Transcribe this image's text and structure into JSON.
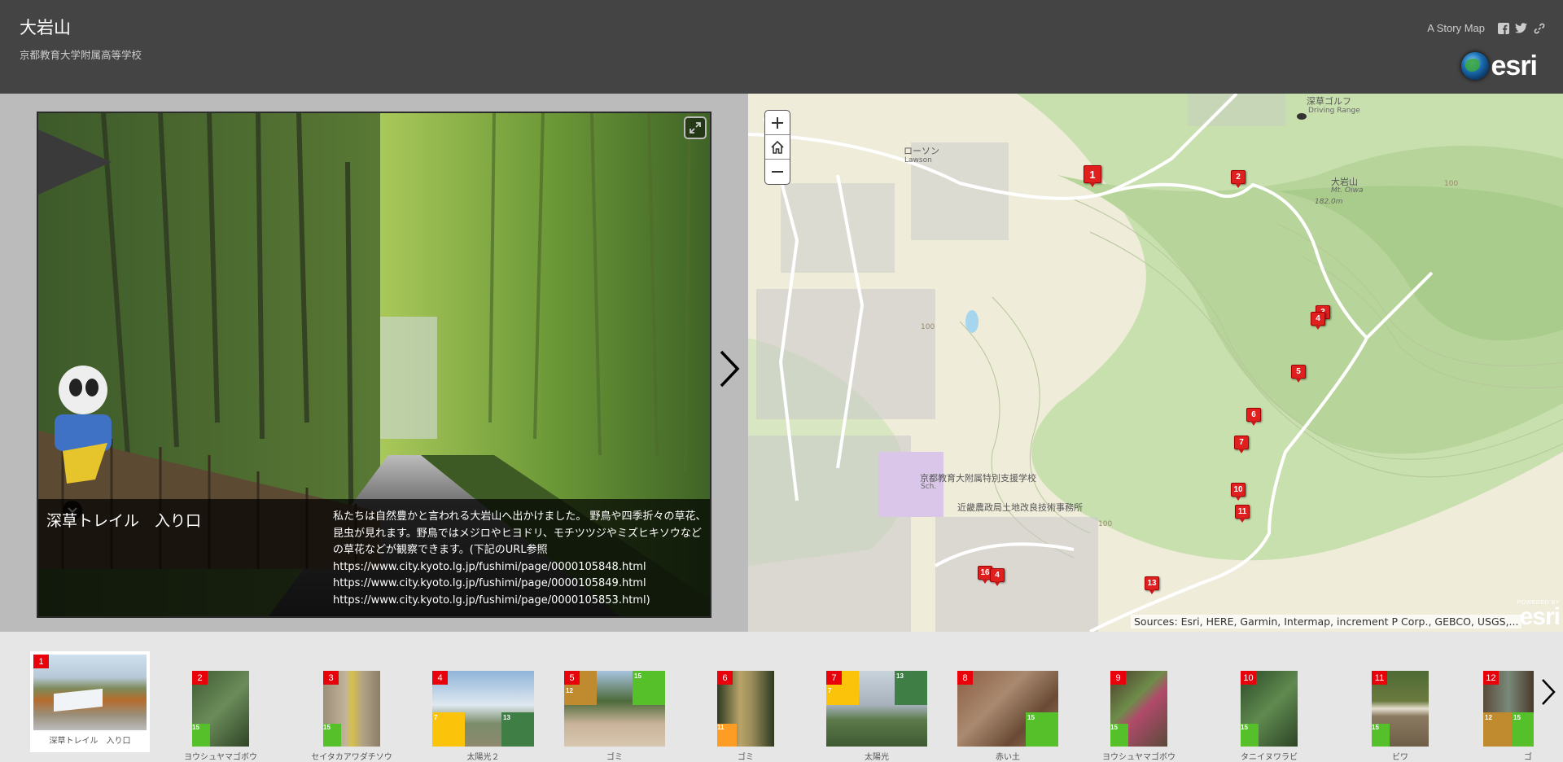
{
  "header": {
    "title": "大岩山",
    "subtitle": "京都教育大学附属高等学校",
    "story_map_label": "A Story Map",
    "share_icons": [
      "facebook-icon",
      "twitter-icon",
      "link-icon"
    ],
    "brand": "esri"
  },
  "media": {
    "caption_title": "深草トレイル　入り口",
    "caption_paragraph": "私たちは自然豊かと言われる大岩山へ出かけました。 野鳥や四季折々の草花、昆虫が見れます。野鳥ではメジロやヒヨドリ、モチツツジやミズヒキソウなどの草花などが観察できます。(下記のURL参照",
    "caption_links": [
      "https://www.city.kyoto.lg.jp/fushimi/page/0000105848.html",
      "https://www.city.kyoto.lg.jp/fushimi/page/0000105849.html",
      "https://www.city.kyoto.lg.jp/fushimi/page/0000105853.html)"
    ]
  },
  "map": {
    "zoom_in": "+",
    "home": "home",
    "zoom_out": "−",
    "labels": {
      "lawson_ja": "ローソン",
      "lawson_en": "Lawson",
      "golf_ja": "深草ゴルフ",
      "golf_en": "Driving Range",
      "mountain_ja": "大岩山",
      "mountain_en": "Mt. Oiwa",
      "elevation": "182.0m",
      "school": "京都教育大附属特別支援学校",
      "school_abbr": "Sch.",
      "office": "近畿農政局土地改良技術事務所",
      "contour_100a": "100",
      "contour_100b": "100",
      "contour_100c": "100"
    },
    "pins": [
      "1",
      "2",
      "3",
      "4",
      "5",
      "6",
      "7",
      "10",
      "11",
      "13",
      "16",
      "4"
    ],
    "attribution": "Sources: Esri, HERE, Garmin, Intermap, increment P Corp., GEBCO, USGS,...",
    "powered_by": "POWERED BY",
    "powered_brand": "esri"
  },
  "carousel": {
    "items": [
      {
        "num": "1",
        "label": "深草トレイル　入り口",
        "active": true
      },
      {
        "num": "2",
        "label": "ヨウシュヤマゴボウ"
      },
      {
        "num": "3",
        "label": "セイタカアワダチソウ"
      },
      {
        "num": "4",
        "label": "太陽光２"
      },
      {
        "num": "5",
        "label": "ゴミ"
      },
      {
        "num": "6",
        "label": "ゴミ"
      },
      {
        "num": "7",
        "label": "太陽光"
      },
      {
        "num": "8",
        "label": "赤い土"
      },
      {
        "num": "9",
        "label": "ヨウシュヤマゴボウ"
      },
      {
        "num": "10",
        "label": "タニイヌワラビ"
      },
      {
        "num": "11",
        "label": "ビワ"
      },
      {
        "num": "12",
        "label": "ゴ"
      }
    ],
    "sdg": {
      "s7": "7",
      "s11": "11",
      "s12": "12",
      "s13": "13",
      "s15": "15"
    }
  },
  "colors": {
    "header_bg": "#444444",
    "pin_red": "#e01f1f",
    "sdg7": "#fcc30b",
    "sdg11": "#fd9d24",
    "sdg12": "#bf8b2e",
    "sdg13": "#3f7e44",
    "sdg15": "#56c02b"
  }
}
